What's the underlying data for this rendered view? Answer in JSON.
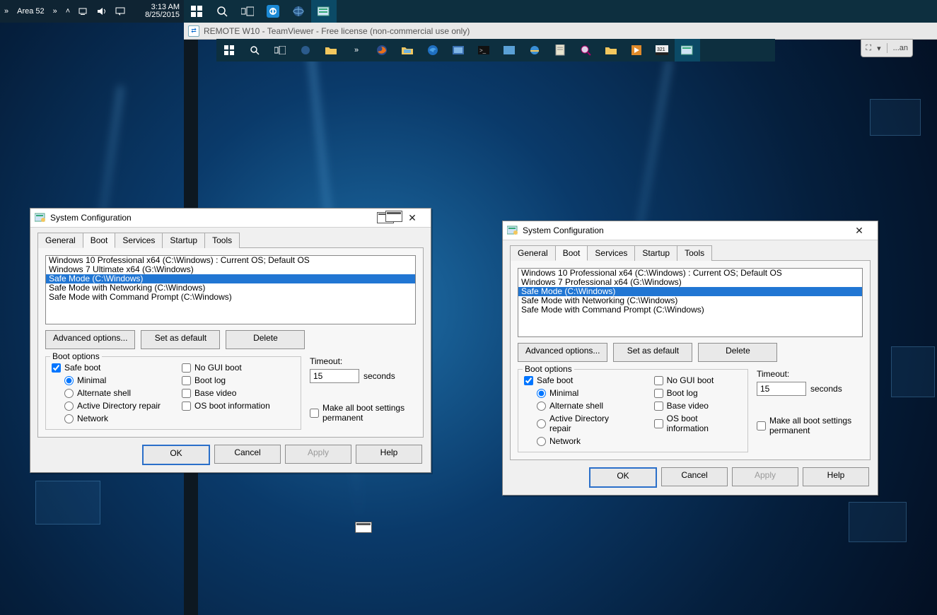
{
  "host": {
    "label": "Area 52",
    "time": "3:13 AM",
    "date": "8/25/2015"
  },
  "remote": {
    "titlebar": "REMOTE W10 - TeamViewer - Free license (non-commercial use only)",
    "handle": "...an"
  },
  "msconfig": {
    "title": "System Configuration",
    "tabs": [
      "General",
      "Boot",
      "Services",
      "Startup",
      "Tools"
    ],
    "active_tab": "Boot",
    "buttons": {
      "adv": "Advanced options...",
      "setdef": "Set as default",
      "del": "Delete",
      "ok": "OK",
      "cancel": "Cancel",
      "apply": "Apply",
      "help": "Help"
    },
    "boot": {
      "legend": "Boot options",
      "safe_boot": "Safe boot",
      "minimal": "Minimal",
      "altshell": "Alternate shell",
      "adrepair": "Active Directory repair",
      "network": "Network",
      "nogui": "No GUI boot",
      "bootlog": "Boot log",
      "basevideo": "Base video",
      "osinfo": "OS boot information",
      "timeout_label": "Timeout:",
      "timeout_value": "15",
      "seconds": "seconds",
      "permanent": "Make all boot settings permanent"
    }
  },
  "left_list": [
    "Windows 10 Professional x64 (C:\\Windows) : Current OS; Default OS",
    "Windows 7 Ultimate x64 (G:\\Windows)",
    "Safe Mode (C:\\Windows)",
    "Safe Mode with Networking (C:\\Windows)",
    "Safe Mode with Command Prompt (C:\\Windows)"
  ],
  "right_list": [
    "Windows 10 Professional x64 (C:\\Windows) : Current OS; Default OS",
    "Windows 7 Professional x64 (G:\\Windows)",
    "Safe Mode (C:\\Windows)",
    "Safe Mode with Networking (C:\\Windows)",
    "Safe Mode with Command Prompt (C:\\Windows)"
  ]
}
